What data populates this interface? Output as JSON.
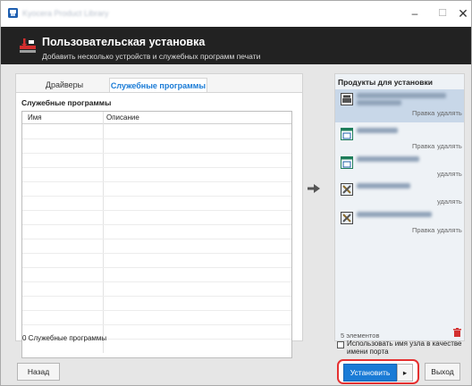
{
  "window": {
    "title": "Kyocera Product Library"
  },
  "header": {
    "title": "Пользовательская установка",
    "subtitle": "Добавить несколько устройств и служебных программ печати"
  },
  "tabs": {
    "drivers": "Драйверы",
    "utilities": "Служебные программы"
  },
  "left": {
    "section_title": "Служебные программы",
    "columns": {
      "name": "Имя",
      "description": "Описание"
    },
    "count_label": "0 Служебные программы"
  },
  "right": {
    "title": "Продукты для установки",
    "items": [
      {
        "icon": "printer-icon",
        "edit": "Правка",
        "delete": "удалять"
      },
      {
        "icon": "window-icon",
        "edit": "Правка",
        "delete": "удалять"
      },
      {
        "icon": "window-icon",
        "edit": "",
        "delete": "удалять"
      },
      {
        "icon": "tools-icon",
        "edit": "",
        "delete": "удалять"
      },
      {
        "icon": "tools-icon",
        "edit": "Правка",
        "delete": "удалять"
      }
    ],
    "count": "5 элементов",
    "port_option": "Использовать имя узла в качестве имени порта"
  },
  "buttons": {
    "back": "Назад",
    "install": "Установить",
    "more": "▸",
    "exit": "Выход"
  },
  "colors": {
    "accent": "#1a7bd6",
    "header_bg": "#222222",
    "highlight": "#e53030"
  }
}
